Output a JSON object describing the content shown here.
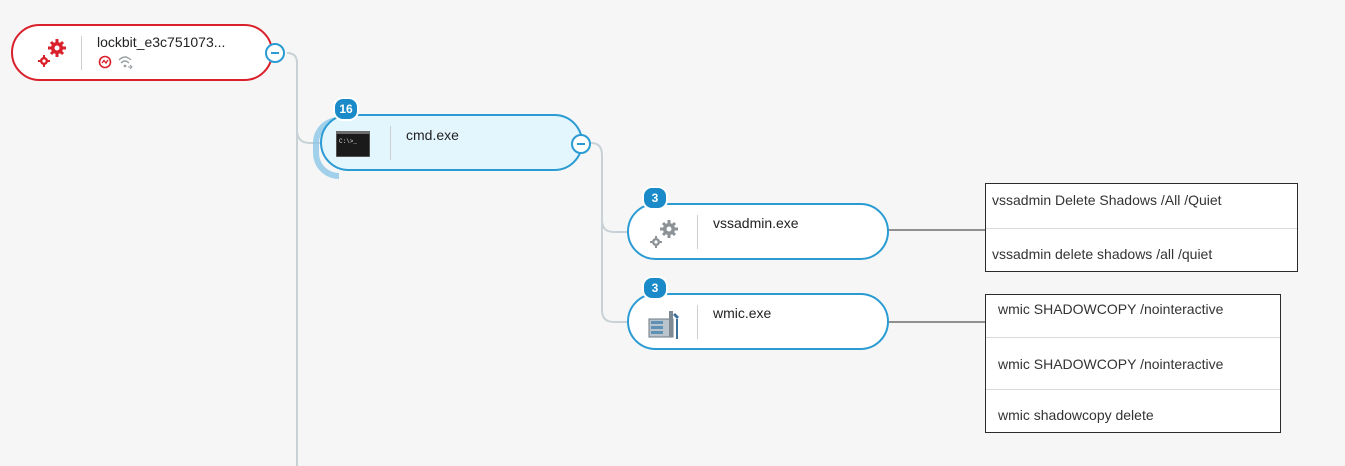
{
  "nodes": {
    "root": {
      "name": "lockbit_e3c751073...",
      "icon": "gears-icon",
      "status_icons": [
        "network-blocked-icon",
        "wifi-icon"
      ]
    },
    "cmd": {
      "name": "cmd.exe",
      "badge": "16",
      "icon": "console-icon"
    },
    "vssadmin": {
      "name": "vssadmin.exe",
      "badge": "3",
      "icon": "gears-icon"
    },
    "wmic": {
      "name": "wmic.exe",
      "badge": "3",
      "icon": "wmic-tool-icon"
    }
  },
  "command_lines": {
    "vssadmin": [
      "vssadmin Delete Shadows /All /Quiet",
      "vssadmin delete shadows /all /quiet"
    ],
    "wmic": [
      "wmic SHADOWCOPY /nointeractive",
      "wmic SHADOWCOPY /nointeractive",
      "wmic shadowcopy delete"
    ]
  },
  "colors": {
    "root_border": "#d9202b",
    "node_border": "#2a9bd3",
    "badge": "#1a8bc8",
    "connector": "#c8d2d6"
  }
}
